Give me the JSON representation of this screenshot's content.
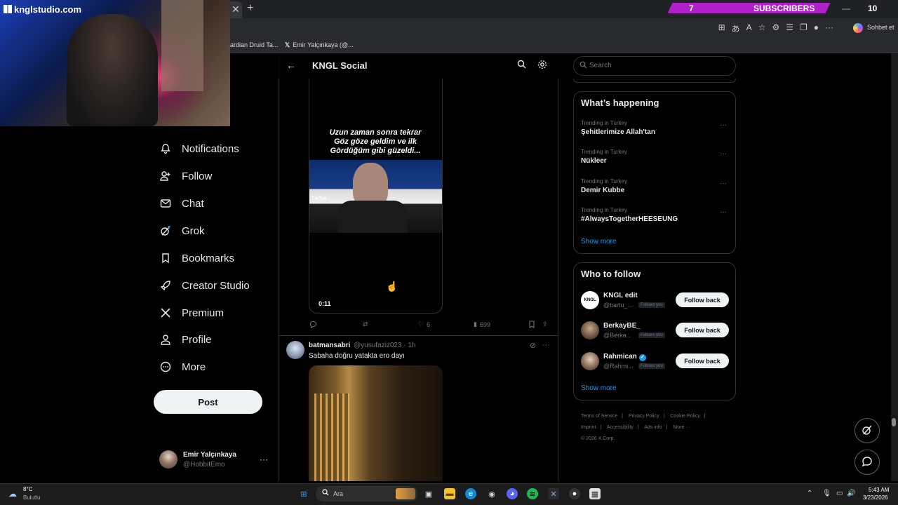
{
  "overlay": {
    "brand": "knglstudio.com",
    "subscribers_count": "7",
    "subscribers_label": "SUBSCRIBERS",
    "corner_number": "10"
  },
  "browser": {
    "copilot_label": "Sohbet et",
    "bookmarks": [
      {
        "label": "ardian Druid Ta..."
      },
      {
        "label": "Emir Yalçınkaya (@..."
      }
    ]
  },
  "nav": {
    "items": [
      {
        "label": "Notifications",
        "icon": "bell-icon"
      },
      {
        "label": "Follow",
        "icon": "person-add-icon"
      },
      {
        "label": "Chat",
        "icon": "mail-icon"
      },
      {
        "label": "Grok",
        "icon": "grok-icon"
      },
      {
        "label": "Bookmarks",
        "icon": "bookmark-icon"
      },
      {
        "label": "Creator Studio",
        "icon": "rocket-icon"
      },
      {
        "label": "Premium",
        "icon": "x-logo-icon"
      },
      {
        "label": "Profile",
        "icon": "profile-icon"
      },
      {
        "label": "More",
        "icon": "more-circle-icon"
      }
    ],
    "post_label": "Post",
    "account": {
      "name": "Emir Yalçınkaya",
      "handle": "@HobbitEmo"
    }
  },
  "center": {
    "title": "KNGL Social",
    "video": {
      "caption_line1": "Uzun zaman sonra tekrar",
      "caption_line2": "Göz göze geldim ve ilk",
      "caption_line3": "Gördüğüm gibi güzeldi...",
      "watermark": "TikTok",
      "duration": "0:11"
    },
    "actions": {
      "likes": "6",
      "views": "699"
    },
    "post": {
      "author": "batmansabri",
      "meta": "@yusufaziz023 · 1h",
      "text": "Sabaha doğru yatakta ero dayı"
    }
  },
  "right": {
    "search_placeholder": "Search",
    "happening_title": "What’s happening",
    "trends": [
      {
        "label": "Trending in Turkey",
        "name": "Şehitlerimize Allah'tan"
      },
      {
        "label": "Trending in Turkey",
        "name": "Nükleer"
      },
      {
        "label": "Trending in Turkey",
        "name": "Demir Kubbe"
      },
      {
        "label": "Trending in Turkey",
        "name": "#AlwaysTogetherHEESEUNG"
      }
    ],
    "show_more": "Show more",
    "wtf_title": "Who to follow",
    "who_to_follow": [
      {
        "name": "KNGL edit",
        "handle": "@bartu_...",
        "badge": "Follows you",
        "button": "Follow back"
      },
      {
        "name": "BerkayBE_",
        "handle": "@Berka...",
        "badge": "Follows you",
        "button": "Follow back"
      },
      {
        "name": "Rahmican",
        "handle": "@Rahmi...",
        "badge": "Follows you",
        "button": "Follow back"
      }
    ],
    "footer": [
      "Terms of Service",
      "Privacy Policy",
      "Cookie Policy",
      "Imprint",
      "Accessibility",
      "Ads info",
      "More ···",
      "© 2026 X Corp."
    ]
  },
  "taskbar": {
    "weather_temp": "8°C",
    "weather_desc": "Bulutlu",
    "search_text": "Ara",
    "time": "5:43 AM",
    "date": "3/23/2026"
  }
}
